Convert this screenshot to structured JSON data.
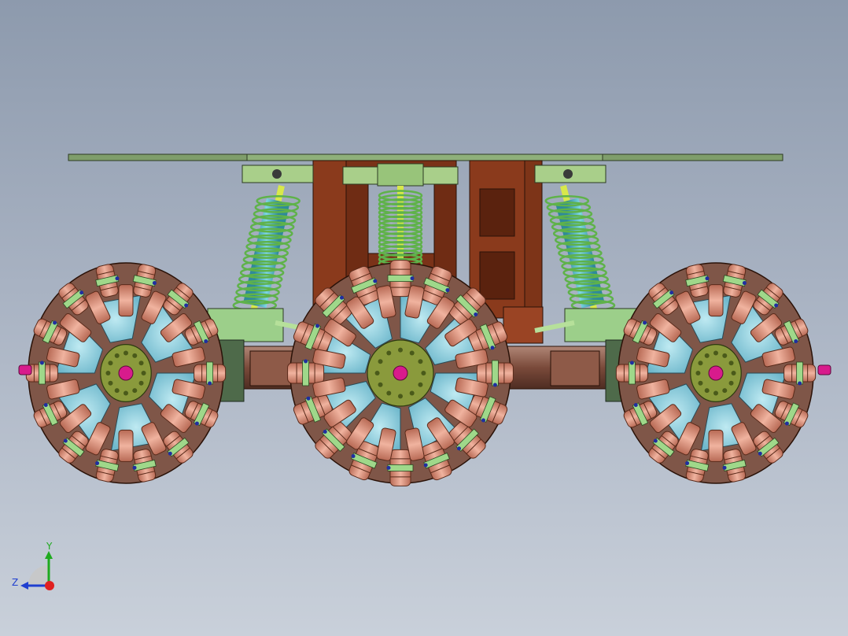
{
  "colors": {
    "background_top": "#8d9aad",
    "background_bottom": "#c9d0da",
    "top_plate": "#7f9e6b",
    "bracket_green": "#a9cf8a",
    "frame_brown": "#8a3a1c",
    "spring_green": "#5fb24a",
    "damper_cyan": "#47b6c8",
    "roller_copper": "#d98c74",
    "hub_olive": "#8a9a3c",
    "window_blue": "#8fd0e0",
    "axle_brown": "#7a4a3a",
    "hub_magenta": "#d81b8c",
    "axis_y": "#1faa1f",
    "axis_z": "#1f3fd0",
    "axis_x": "#e02020"
  },
  "triad": {
    "y_label": "Y",
    "z_label": "Z"
  }
}
